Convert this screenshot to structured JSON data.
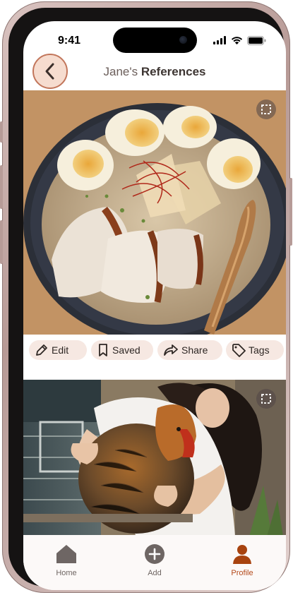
{
  "status_bar": {
    "time": "9:41"
  },
  "header": {
    "title_prefix": "Jane's",
    "title_main": "References"
  },
  "photos": [
    {
      "subject": "ramen bowl with eggs and pork"
    },
    {
      "subject": "woman hugging a chicken"
    }
  ],
  "actions": [
    {
      "label": "Edit",
      "icon": "pencil-icon"
    },
    {
      "label": "Saved",
      "icon": "bookmark-icon"
    },
    {
      "label": "Share",
      "icon": "share-arrow-icon"
    },
    {
      "label": "Tags",
      "icon": "tag-icon"
    }
  ],
  "bottom_nav": {
    "items": [
      {
        "label": "Home",
        "icon": "home-icon",
        "active": false
      },
      {
        "label": "Add",
        "icon": "plus-circle-icon",
        "active": false
      },
      {
        "label": "Profile",
        "icon": "person-icon",
        "active": true
      }
    ]
  },
  "colors": {
    "accent": "#b44a1b",
    "chip_bg": "#f6e8e2",
    "back_button_bg": "#f6dccf",
    "frame": "#b79a96"
  }
}
